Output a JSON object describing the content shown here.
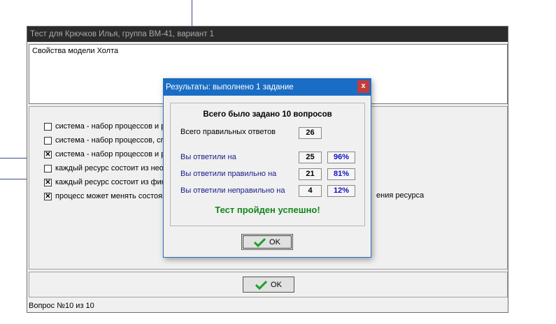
{
  "main_window": {
    "title": "Тест для Крючков Илья, группа ВМ-41, вариант 1",
    "question": "Свойства модели Холта",
    "options": [
      {
        "text": "система -  набор процессов и ре",
        "checked": false
      },
      {
        "text": "система - набор процессов, спо",
        "checked": false
      },
      {
        "text": "система - набор процессов и ре",
        "checked": true
      },
      {
        "text": "каждый ресурс состоит из неог",
        "checked": false
      },
      {
        "text": "каждый ресурс состоит из фик",
        "checked": true
      },
      {
        "text": "процесс может менять состоян",
        "checked": true
      }
    ],
    "option_tail": "ения ресурса",
    "ok_label": "OK",
    "status": "Вопрос №10 из 10"
  },
  "dialog": {
    "title": "Результаты: выполнено 1 задание",
    "close_label": "x",
    "heading": "Всего было задано 10 вопросов",
    "total_correct_label": "Всего правильных ответов",
    "total_correct_value": "26",
    "answered_label": "Вы ответили на",
    "answered_value": "25",
    "answered_pct": "96%",
    "correct_label": "Вы ответили правильно на",
    "correct_value": "21",
    "correct_pct": "81%",
    "wrong_label": "Вы ответили неправильно на",
    "wrong_value": "4",
    "wrong_pct": "12%",
    "result_message": "Тест пройден успешно!",
    "ok_label": "OK"
  },
  "colors": {
    "dialog_title_bg": "#1a6dc4",
    "success": "#13871a",
    "percent": "#1010c0",
    "check_icon": "#1e9e2a"
  }
}
